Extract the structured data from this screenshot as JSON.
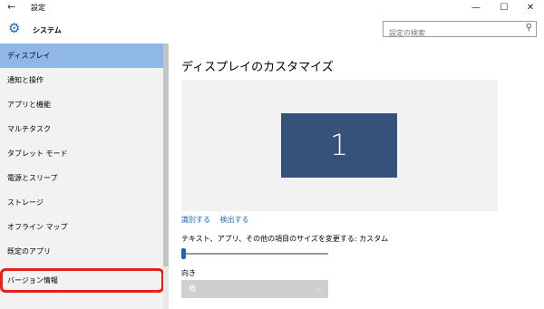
{
  "window": {
    "title": "設定",
    "back_icon": "←",
    "minimize_icon": "—",
    "maximize_icon": "☐",
    "close_icon": "✕"
  },
  "header": {
    "title": "システム",
    "gear_icon": "⚙"
  },
  "search": {
    "placeholder": "設定の検索",
    "icon": "⚲"
  },
  "sidebar": {
    "items": [
      {
        "label": "ディスプレイ",
        "selected": true
      },
      {
        "label": "通知と操作"
      },
      {
        "label": "アプリと機能"
      },
      {
        "label": "マルチタスク"
      },
      {
        "label": "タブレット モード"
      },
      {
        "label": "電源とスリープ"
      },
      {
        "label": "ストレージ"
      },
      {
        "label": "オフライン マップ"
      },
      {
        "label": "既定のアプリ"
      },
      {
        "label": "バージョン情報",
        "highlighted": true
      }
    ]
  },
  "main": {
    "title": "ディスプレイのカスタマイズ",
    "monitor_number": "1",
    "identify_link": "識別する",
    "detect_link": "検出する",
    "scale_label": "テキスト、アプリ、その他の項目のサイズを変更する: カスタム",
    "orientation_label": "向き",
    "orientation_value": "横",
    "chevron_icon": "⌵"
  },
  "colors": {
    "accent": "#1a66b8",
    "selected_bg": "#8fb8e8",
    "monitor": "#35527a",
    "highlight": "#e8201c"
  }
}
